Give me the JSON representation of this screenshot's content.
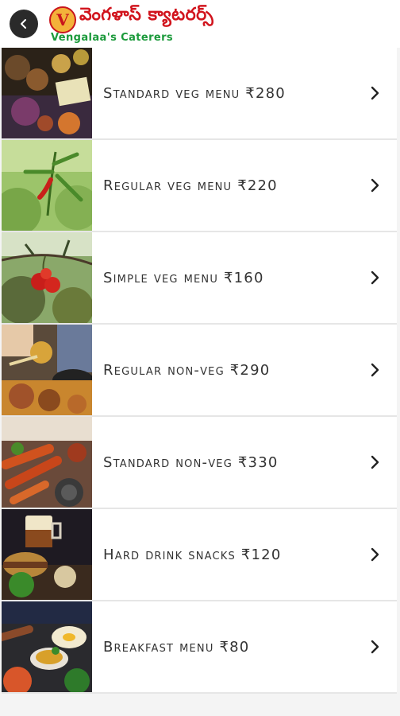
{
  "header": {
    "back_icon": "chevron-left-icon",
    "logo": {
      "telugu_text": "వెంగళాస్ క్యాటరర్స్",
      "english_text": "Vengalaa's Caterers",
      "emblem_letter": "V"
    }
  },
  "colors": {
    "brand_red": "#d1141d",
    "brand_green": "#1b9a3b",
    "back_button": "#2a2a2a",
    "label_text": "#333333"
  },
  "menu": {
    "items": [
      {
        "label": "Standard veg menu ₹280",
        "image": "veg-platter-photo"
      },
      {
        "label": "Regular veg menu ₹220",
        "image": "green-chilli-photo"
      },
      {
        "label": "Simple veg menu ₹160",
        "image": "tomato-plant-photo"
      },
      {
        "label": "Regular non-veg ₹290",
        "image": "non-veg-feast-photo"
      },
      {
        "label": "Standard non-veg ₹330",
        "image": "fried-chicken-photo"
      },
      {
        "label": "Hard drink snacks ₹120",
        "image": "drink-and-snack-photo"
      },
      {
        "label": "Breakfast menu ₹80",
        "image": "breakfast-spread-photo"
      }
    ]
  }
}
